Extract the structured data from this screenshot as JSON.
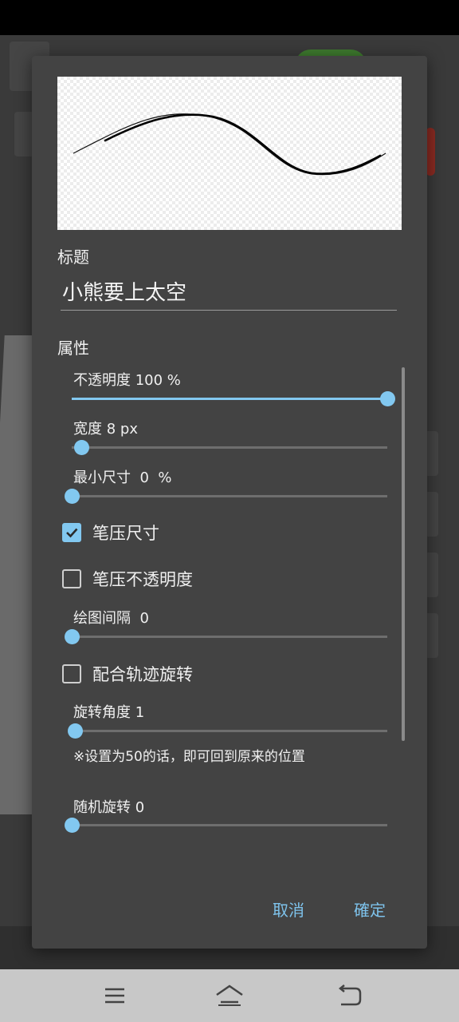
{
  "dialog": {
    "title_label": "标题",
    "title_value": "小熊要上太空",
    "properties_label": "属性",
    "sliders": [
      {
        "label": "不透明度 100 %",
        "value": 1.0
      },
      {
        "label": "宽度 8 px",
        "value": 0.03
      },
      {
        "label": "最小尺寸  0  %",
        "value": 0.0
      },
      {
        "label": "绘图间隔  0",
        "value": 0.0
      },
      {
        "label": "旋转角度 1",
        "value": 0.01
      },
      {
        "label": "随机旋转 0",
        "value": 0.0
      }
    ],
    "checkboxes": [
      {
        "label": "笔压尺寸",
        "checked": true
      },
      {
        "label": "笔压不透明度",
        "checked": false
      },
      {
        "label": "配合轨迹旋转",
        "checked": false
      }
    ],
    "rotation_note": "※设置为50的话，即可回到原来的位置",
    "cancel_label": "取消",
    "ok_label": "確定"
  },
  "colors": {
    "accent": "#82c8f0",
    "dialog_bg": "#434343",
    "button_text": "#7ec3ec"
  },
  "icons": {
    "nav_menu": "menu-icon",
    "nav_home": "home-icon",
    "nav_back": "back-icon",
    "check": "check-icon"
  }
}
